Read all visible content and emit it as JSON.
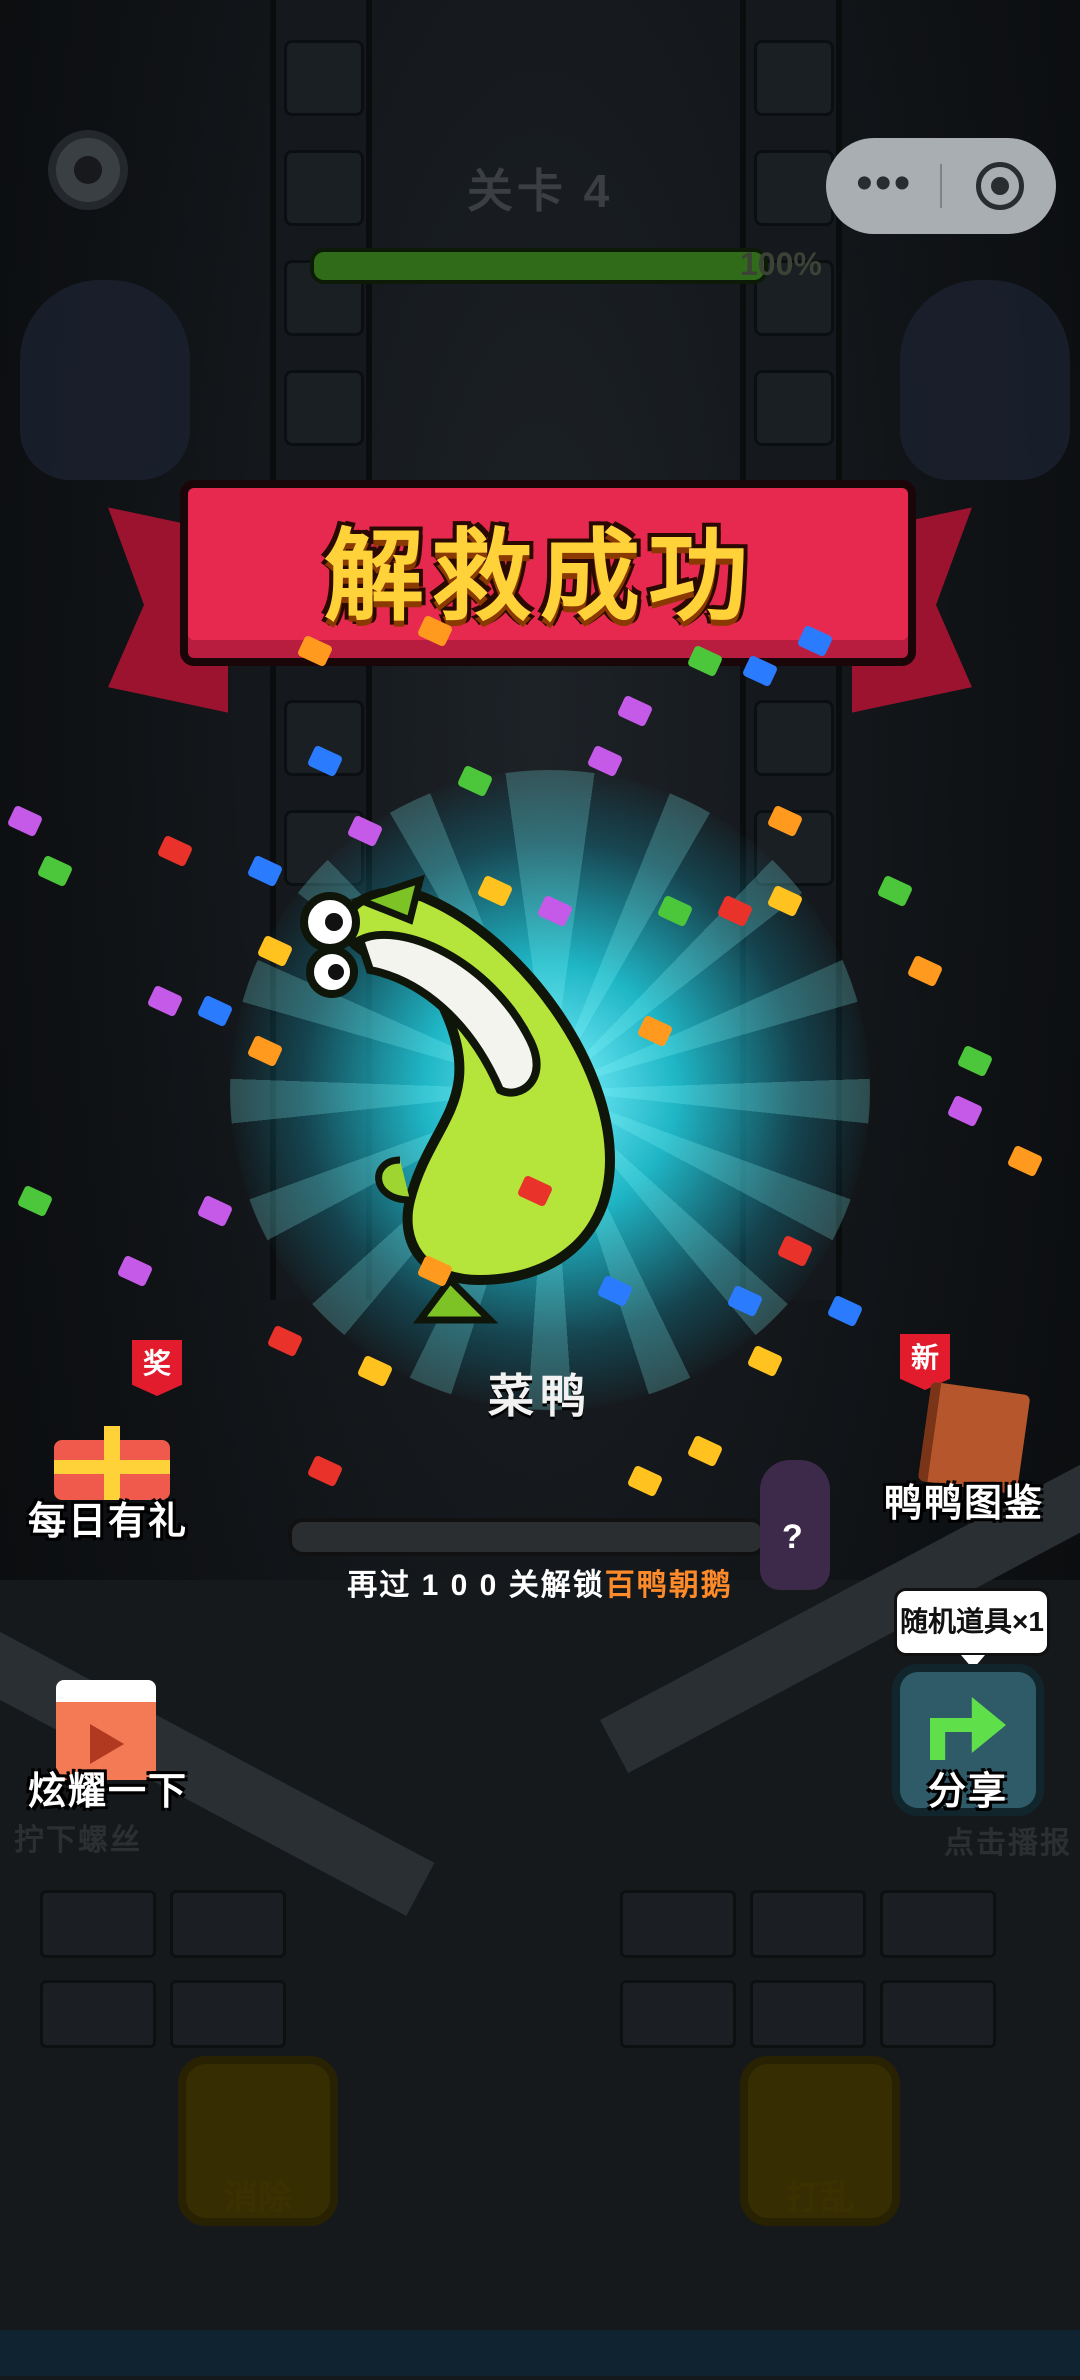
{
  "hud": {
    "level_title": "关卡 4",
    "progress_value": 1.0,
    "progress_text": "100%",
    "capsule_more": "•••"
  },
  "banner": {
    "title": "解救成功"
  },
  "duck": {
    "name": "菜鸭"
  },
  "daily_gift": {
    "badge": "奖",
    "label": "每日有礼"
  },
  "duck_album": {
    "badge": "新",
    "label": "鸭鸭图鉴"
  },
  "unlock": {
    "progress_value": 0.0,
    "text_before": "再过 1 0 0 关解锁",
    "highlight": "百鸭朝鹅",
    "locked_mark": "?"
  },
  "show_off": {
    "label": "炫耀一下",
    "underlay": "拧下螺丝"
  },
  "share": {
    "tooltip": "随机道具×1",
    "label": "分享",
    "underlay": "点击播报"
  },
  "tools": [
    {
      "label": "消除"
    },
    {
      "label": "打乱"
    }
  ],
  "colors": {
    "banner_red": "#e8294f",
    "banner_text": "#ffd23a",
    "highlight_orange": "#ff8a2a",
    "glow_cyan": "#1fb6c6",
    "share_green": "#5fe04a"
  }
}
